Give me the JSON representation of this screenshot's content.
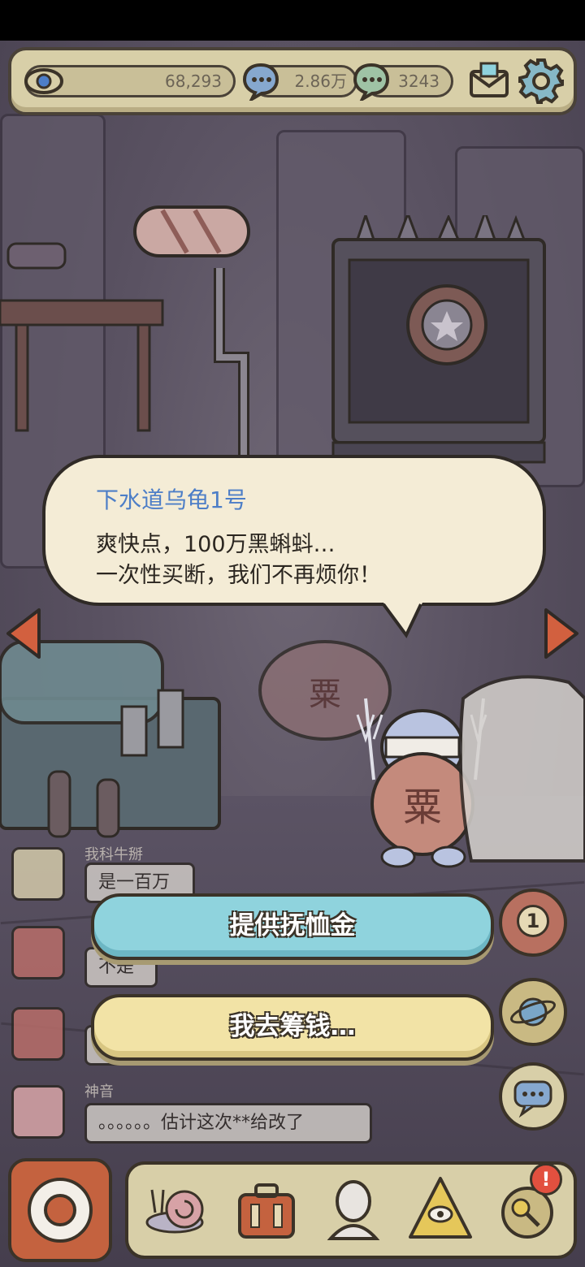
{
  "stats": {
    "views": "68,293",
    "likes": "2.86万",
    "comments": "3243"
  },
  "dialog": {
    "speaker": "下水道乌龟1号",
    "line1": "爽快点，100万黑蝌蚪…",
    "line2": "一次性买断，我们不再烦你！"
  },
  "chat": [
    {
      "name": "我科牛掰",
      "message": "是一百万"
    },
    {
      "name": "",
      "message": "不是"
    },
    {
      "name": "",
      "message": ""
    },
    {
      "name": "神音",
      "message": "。。。。。。估计这次**给改了"
    }
  ],
  "buttons": {
    "offer": "提供抚恤金",
    "raise": "我去筹钱…"
  },
  "side": {
    "badge": "1"
  },
  "nav": {
    "alert": "!"
  },
  "colors": {
    "speaker": "#4d7ec7",
    "button_blue": "#8fd3dd",
    "button_yellow": "#f2e3a6",
    "panel": "#d8cfa8",
    "arrow": "#d2603f"
  },
  "icons": {
    "views": "eye-icon",
    "likes": "chat-bubble-icon",
    "comments": "chat-bubble-icon",
    "mail": "mail-icon",
    "settings": "gear-icon",
    "left": "triangle-left-icon",
    "right": "triangle-right-icon",
    "badge": "numbered-badge-icon",
    "planet": "planet-icon",
    "chat": "speech-bubble-icon",
    "record": "record-icon",
    "snail": "snail-icon",
    "suitcase": "suitcase-icon",
    "bust": "statue-bust-icon",
    "pyramid": "eye-pyramid-icon",
    "key": "key-icon"
  }
}
